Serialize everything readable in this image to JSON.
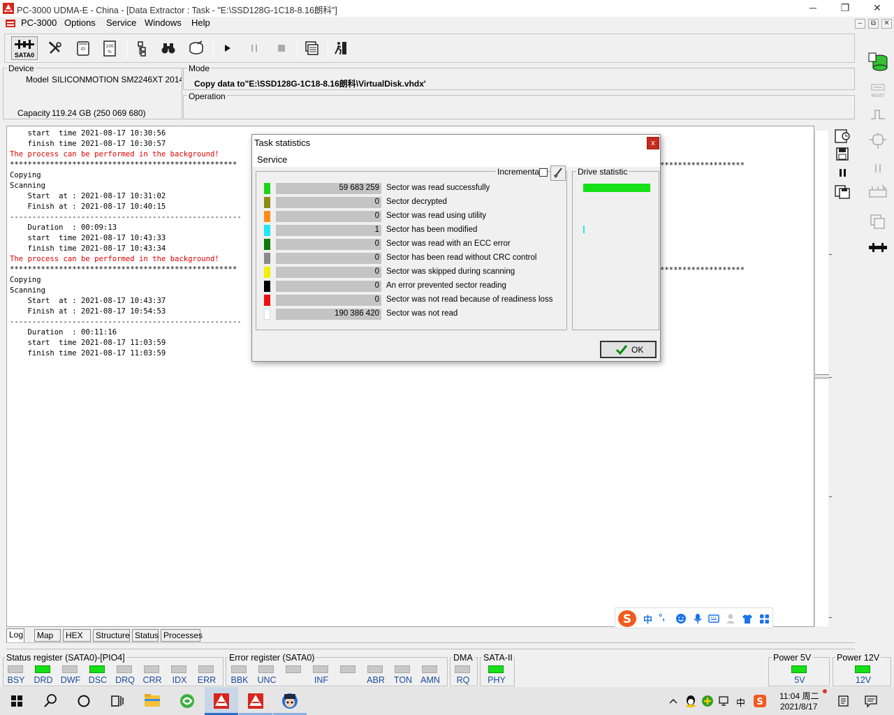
{
  "window": {
    "title": "PC-3000 UDMA-E - China - [Data Extractor : Task - \"E:\\SSD128G-1C18-8.16朗科\"]",
    "minimize_glyph": "─",
    "restore_glyph": "❐",
    "close_glyph": "✕"
  },
  "menu": {
    "app_item": "PC-3000",
    "items": [
      "Options",
      "Service",
      "Windows",
      "Help"
    ],
    "mdi_min": "–",
    "mdi_restore": "⧉",
    "mdi_close": "✕"
  },
  "toolbar": {
    "sata_label": "SATA0"
  },
  "device": {
    "group_label": "Device",
    "model_caption": "Model",
    "model_value": "SILICONMOTION SM2246XT 2014112",
    "capacity_caption": "Capacity",
    "capacity_value": "119.24 GB (250 069 680)"
  },
  "mode": {
    "group_label": "Mode",
    "text": "Copy data to\"E:\\SSD128G-1C18-8.16朗科\\VirtualDisk.vhdx'"
  },
  "operation": {
    "group_label": "Operation"
  },
  "log": {
    "lines": [
      {
        "text": "    start  time 2021-08-17 10:30:56",
        "color": "black"
      },
      {
        "text": "    finish time 2021-08-17 10:30:57",
        "color": "black"
      },
      {
        "text": "The process can be performed in the background!",
        "color": "red"
      },
      {
        "text": "***************************************************",
        "color": "black"
      },
      {
        "text": "Copying",
        "color": "black"
      },
      {
        "text": "Scanning",
        "color": "black"
      },
      {
        "text": "    Start  at : 2021-08-17 10:31:02",
        "color": "black"
      },
      {
        "text": "    Finish at : 2021-08-17 10:40:15",
        "color": "black"
      },
      {
        "text": "----------------------------------------------------",
        "color": "black"
      },
      {
        "text": "    Duration  : 00:09:13",
        "color": "black"
      },
      {
        "text": "    start  time 2021-08-17 10:43:33",
        "color": "black"
      },
      {
        "text": "    finish time 2021-08-17 10:43:34",
        "color": "black"
      },
      {
        "text": "The process can be performed in the background!",
        "color": "red"
      },
      {
        "text": "***************************************************",
        "color": "black"
      },
      {
        "text": "Copying",
        "color": "black"
      },
      {
        "text": "Scanning",
        "color": "black"
      },
      {
        "text": "    Start  at : 2021-08-17 10:43:37",
        "color": "black"
      },
      {
        "text": "    Finish at : 2021-08-17 10:54:53",
        "color": "black"
      },
      {
        "text": "----------------------------------------------------",
        "color": "black"
      },
      {
        "text": "    Duration  : 00:11:16",
        "color": "black"
      },
      {
        "text": "    start  time 2021-08-17 11:03:59",
        "color": "black"
      },
      {
        "text": "    finish time 2021-08-17 11:03:59",
        "color": "black"
      }
    ],
    "right_asterisks_1": "*******************",
    "right_asterisks_2": "*******************"
  },
  "tabs": [
    "Log",
    "Map",
    "HEX",
    "Structure",
    "Status",
    "Processes"
  ],
  "dialog": {
    "title": "Task statistics",
    "close_glyph": "x",
    "menu": "Service",
    "incremental_label": "Incremental",
    "drive_statistic_label": "Drive statistic",
    "ok_label": "OK",
    "rows": [
      {
        "color": "#1cd41c",
        "value": "59 683 259",
        "label": "Sector was read successfully"
      },
      {
        "color": "#8c8c14",
        "value": "0",
        "label": "Sector decrypted"
      },
      {
        "color": "#ff8c1a",
        "value": "0",
        "label": "Sector was read using utility"
      },
      {
        "color": "#22e6f0",
        "value": "1",
        "label": "Sector has been modified"
      },
      {
        "color": "#0c7a0c",
        "value": "0",
        "label": "Sector was read with an ECC error"
      },
      {
        "color": "#8a8a8a",
        "value": "0",
        "label": "Sector has been read without CRC control"
      },
      {
        "color": "#f0f000",
        "value": "0",
        "label": "Sector was skipped during scanning"
      },
      {
        "color": "#000000",
        "value": "0",
        "label": "An error prevented sector reading"
      },
      {
        "color": "#ee1111",
        "value": "0",
        "label": "Sector was not read because of readiness loss"
      },
      {
        "color": "#ffffff",
        "value": "190 386 420",
        "label": "Sector was not read"
      }
    ]
  },
  "ime": {
    "items": [
      "中",
      "°,"
    ]
  },
  "status": {
    "status_reg_label": "Status register (SATA0)-[PIO4]",
    "status_regs": [
      {
        "name": "BSY",
        "on": false
      },
      {
        "name": "DRD",
        "on": true
      },
      {
        "name": "DWF",
        "on": false
      },
      {
        "name": "DSC",
        "on": true
      },
      {
        "name": "DRQ",
        "on": false
      },
      {
        "name": "CRR",
        "on": false
      },
      {
        "name": "IDX",
        "on": false
      },
      {
        "name": "ERR",
        "on": false
      }
    ],
    "error_reg_label": "Error register (SATA0)",
    "error_regs": [
      {
        "name": "BBK",
        "on": false
      },
      {
        "name": "UNC",
        "on": false
      },
      {
        "name": "",
        "on": false
      },
      {
        "name": "INF",
        "on": false
      },
      {
        "name": "",
        "on": false
      },
      {
        "name": "ABR",
        "on": false
      },
      {
        "name": "TON",
        "on": false
      },
      {
        "name": "AMN",
        "on": false
      }
    ],
    "dma_label": "DMA",
    "dma_reg": "RQ",
    "sata2_label": "SATA-II",
    "sata2_reg": "PHY",
    "power5_label": "Power 5V",
    "power5_reg": "5V",
    "power12_label": "Power 12V",
    "power12_reg": "12V"
  },
  "taskbar": {
    "ime_zh": "中",
    "time": "11:04 周二",
    "date": "2021/8/17"
  }
}
